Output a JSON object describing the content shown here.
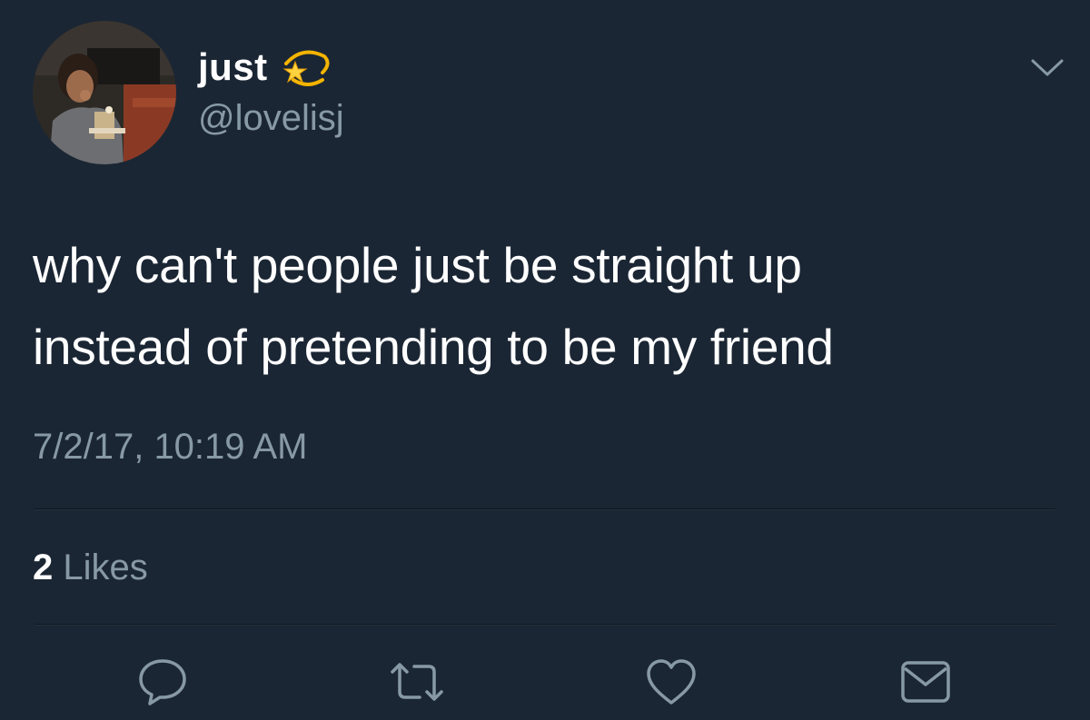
{
  "author": {
    "display_name": "just",
    "handle": "@lovelisj",
    "badge_emoji": "dizzy-star-emoji"
  },
  "tweet": {
    "text_lines": [
      "why can't people just be straight up",
      "instead of pretending to be my friend"
    ],
    "timestamp": "7/2/17, 10:19 AM"
  },
  "stats": {
    "likes_count": "2",
    "likes_label": "Likes"
  },
  "actions": [
    {
      "name": "reply-icon"
    },
    {
      "name": "retweet-icon"
    },
    {
      "name": "like-icon"
    },
    {
      "name": "message-icon"
    }
  ],
  "colors": {
    "background": "#1b2634",
    "secondary_text": "#8899a6",
    "primary_text": "#ffffff"
  }
}
